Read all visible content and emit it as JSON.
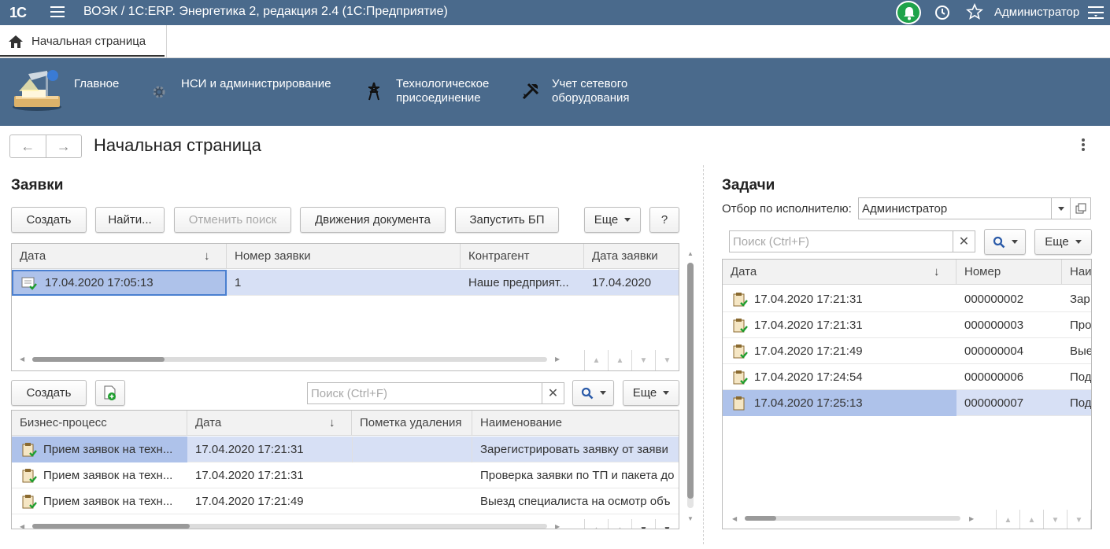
{
  "app": {
    "logo": "1С",
    "title": "ВОЭК / 1С:ERP. Энергетика 2, редакция 2.4  (1С:Предприятие)",
    "user": "Администратор"
  },
  "tabs": {
    "home": "Начальная страница"
  },
  "sections": [
    {
      "label_line1": "Главное",
      "label_line2": ""
    },
    {
      "label_line1": "НСИ и администрирование",
      "label_line2": ""
    },
    {
      "label_line1": "Технологическое",
      "label_line2": "присоединение"
    },
    {
      "label_line1": "Учет сетевого",
      "label_line2": "оборудования"
    }
  ],
  "page": {
    "title": "Начальная страница"
  },
  "requests": {
    "title": "Заявки",
    "buttons": {
      "create": "Создать",
      "find": "Найти...",
      "cancel_search": "Отменить поиск",
      "movements": "Движения документа",
      "start_bp": "Запустить БП",
      "more": "Еще",
      "help": "?"
    },
    "columns": [
      "Дата",
      "Номер заявки",
      "Контрагент",
      "Дата заявки"
    ],
    "rows": [
      {
        "date": "17.04.2020 17:05:13",
        "number": "1",
        "counterparty": "Наше предприят...",
        "request_date": "17.04.2020"
      }
    ]
  },
  "processes": {
    "buttons": {
      "create": "Создать",
      "more": "Еще"
    },
    "search_placeholder": "Поиск (Ctrl+F)",
    "columns": [
      "Бизнес-процесс",
      "Дата",
      "Пометка удаления",
      "Наименование"
    ],
    "rows": [
      {
        "process": "Прием заявок на техн...",
        "date": "17.04.2020 17:21:31",
        "deleted": "",
        "name": "Зарегистрировать заявку от заяви"
      },
      {
        "process": "Прием заявок на техн...",
        "date": "17.04.2020 17:21:31",
        "deleted": "",
        "name": "Проверка заявки по ТП и пакета до"
      },
      {
        "process": "Прием заявок на техн...",
        "date": "17.04.2020 17:21:49",
        "deleted": "",
        "name": "Выезд специалиста на осмотр объ"
      }
    ]
  },
  "tasks": {
    "title": "Задачи",
    "filter_label": "Отбор по исполнителю:",
    "filter_value": "Администратор",
    "search_placeholder": "Поиск (Ctrl+F)",
    "more": "Еще",
    "columns": [
      "Дата",
      "Номер",
      "Наи"
    ],
    "rows": [
      {
        "date": "17.04.2020 17:21:31",
        "number": "000000002",
        "name": "Зар"
      },
      {
        "date": "17.04.2020 17:21:31",
        "number": "000000003",
        "name": "Про"
      },
      {
        "date": "17.04.2020 17:21:49",
        "number": "000000004",
        "name": "Вые"
      },
      {
        "date": "17.04.2020 17:24:54",
        "number": "000000006",
        "name": "Под"
      },
      {
        "date": "17.04.2020 17:25:13",
        "number": "000000007",
        "name": "Под"
      }
    ]
  },
  "colors": {
    "header_bg": "#4a6a8c",
    "selection": "#d7e0f5",
    "current_cell": "#aec2ea",
    "accent_green": "#1fa34a"
  }
}
